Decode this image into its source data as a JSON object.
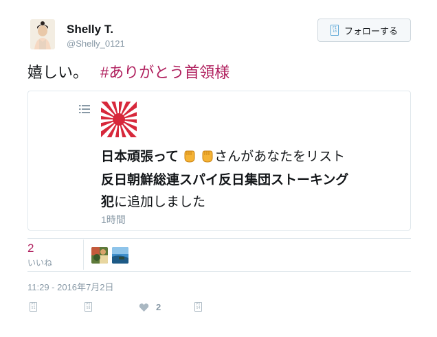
{
  "user": {
    "display_name": "Shelly T.",
    "handle": "@Shelly_0121"
  },
  "follow_button": {
    "label": "フォローする",
    "icon": "follow-icon"
  },
  "tweet": {
    "text": "嬉しい。",
    "hashtag": "#ありがとう首領様"
  },
  "card": {
    "line1_bold": "日本頑張って",
    "line1_emoji": "fist-emoji",
    "line1_rest": "さんがあなたをリスト",
    "line2_bold": "反日朝鮮総連スパイ反日集団ストーキング",
    "line3_bold": "犯",
    "line3_rest": "に追加しました",
    "time": "1時間"
  },
  "stats": {
    "likes_count": "2",
    "likes_label": "いいね"
  },
  "timestamp": "11:29 - 2016年7月2日",
  "actions": {
    "like_count": "2"
  },
  "colors": {
    "hashtag": "#b0205e",
    "likes_count": "#b0205e",
    "muted": "#8899a6",
    "border": "#e1e8ed",
    "flag_red": "#d7283b"
  }
}
